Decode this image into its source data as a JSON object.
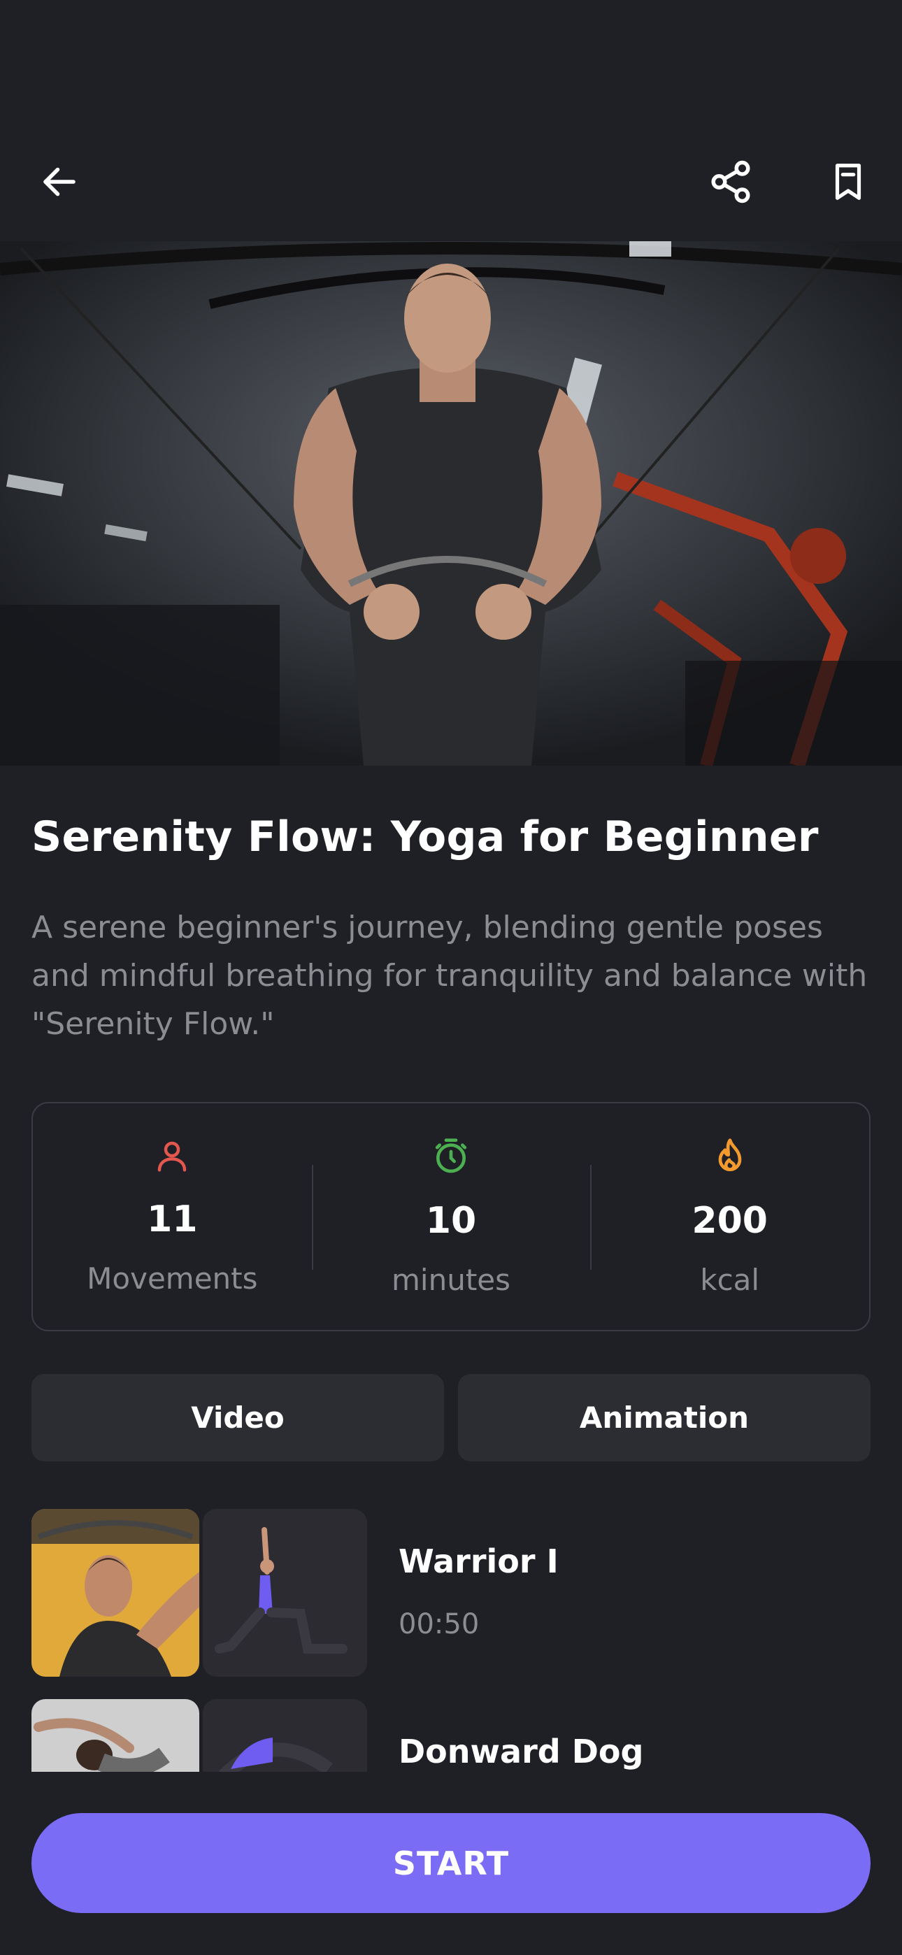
{
  "header": {
    "back_icon": "arrow-left-icon",
    "share_icon": "share-icon",
    "bookmark_icon": "bookmark-icon"
  },
  "workout": {
    "title": "Serenity Flow: Yoga for Beginner",
    "description": "A serene beginner's journey, blending gentle poses and mindful breathing for tranquility and balance with \"Serenity Flow.\""
  },
  "stats": [
    {
      "icon": "person-icon",
      "color": "#e4574f",
      "value": "11",
      "label": "Movements"
    },
    {
      "icon": "timer-icon",
      "color": "#4caf50",
      "value": "10",
      "label": "minutes"
    },
    {
      "icon": "flame-icon",
      "color": "#f29a2e",
      "value": "200",
      "label": "kcal"
    }
  ],
  "tabs": {
    "video": "Video",
    "animation": "Animation"
  },
  "exercises": [
    {
      "name": "Warrior I",
      "duration": "00:50"
    },
    {
      "name": "Donward Dog",
      "duration": ""
    }
  ],
  "start_label": "START",
  "colors": {
    "accent": "#7b6cf6",
    "background": "#1f2026",
    "card": "#2c2d33"
  }
}
